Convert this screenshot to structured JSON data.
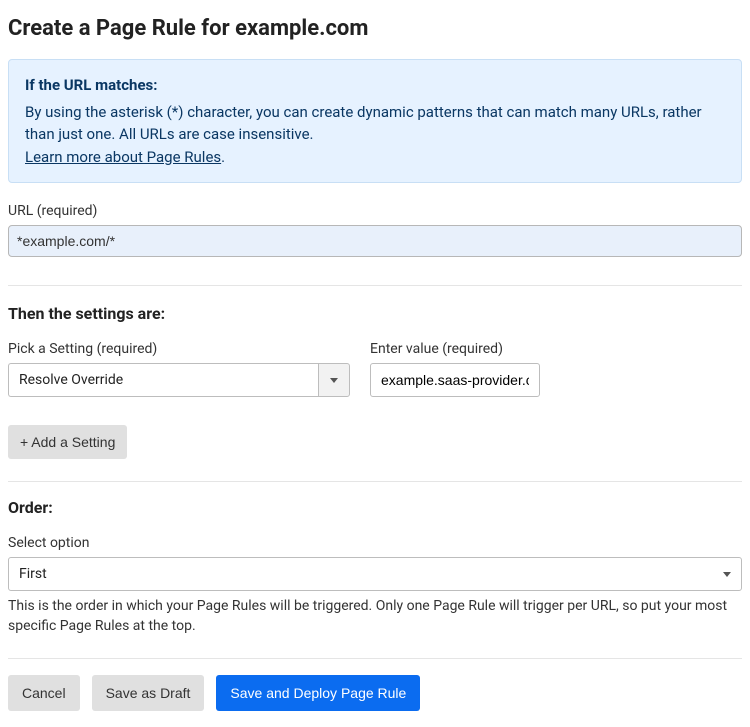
{
  "header": {
    "title": "Create a Page Rule for example.com"
  },
  "info": {
    "title": "If the URL matches:",
    "body": "By using the asterisk (*) character, you can create dynamic patterns that can match many URLs, rather than just one. All URLs are case insensitive.",
    "link": "Learn more about Page Rules",
    "period": "."
  },
  "url": {
    "label": "URL (required)",
    "value": "*example.com/*"
  },
  "settings": {
    "heading": "Then the settings are:",
    "pick_label": "Pick a Setting (required)",
    "selected": "Resolve Override",
    "value_label": "Enter value (required)",
    "value_text": "example.saas-provider.c",
    "add_label": "+ Add a Setting"
  },
  "order": {
    "heading": "Order:",
    "label": "Select option",
    "selected": "First",
    "helper": "This is the order in which your Page Rules will be triggered. Only one Page Rule will trigger per URL, so put your most specific Page Rules at the top."
  },
  "footer": {
    "cancel": "Cancel",
    "save_draft": "Save as Draft",
    "save_deploy": "Save and Deploy Page Rule"
  }
}
